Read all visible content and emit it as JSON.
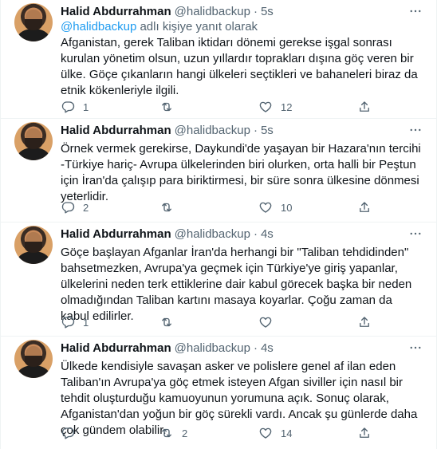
{
  "tweets": [
    {
      "name": "Halid Abdurrahman",
      "handle": "@halidbackup",
      "dot": "·",
      "time": "5s",
      "reply_mention": "@halidbackup",
      "reply_suffix": " adlı kişiye yanıt olarak",
      "text": "Afganistan, gerek Taliban iktidarı dönemi gerekse işgal sonrası kurulan yönetim olsun, uzun yıllardır toprakları dışına göç veren bir ülke. Göçe çıkanların hangi ülkeleri seçtikleri ve bahaneleri biraz da etnik kökenleriyle ilgili.",
      "replies": "1",
      "retweets": "",
      "likes": "12"
    },
    {
      "name": "Halid Abdurrahman",
      "handle": "@halidbackup",
      "dot": "·",
      "time": "5s",
      "text": "Örnek vermek gerekirse, Daykundi'de yaşayan bir Hazara'nın tercihi -Türkiye hariç- Avrupa ülkelerinden biri olurken, orta halli bir Peştun için İran'da çalışıp para biriktirmesi, bir süre sonra ülkesine dönmesi yeterlidir.",
      "replies": "2",
      "retweets": "",
      "likes": "10"
    },
    {
      "name": "Halid Abdurrahman",
      "handle": "@halidbackup",
      "dot": "·",
      "time": "4s",
      "text": "Göçe başlayan Afganlar İran'da herhangi bir \"Taliban tehdidinden\" bahsetmezken, Avrupa'ya geçmek için Türkiye'ye giriş yapanlar, ülkelerini neden terk ettiklerine dair kabul görecek başka bir neden olmadığından Taliban kartını masaya koyarlar. Çoğu zaman da kabul edilirler.",
      "replies": "1",
      "retweets": "",
      "likes": ""
    },
    {
      "name": "Halid Abdurrahman",
      "handle": "@halidbackup",
      "dot": "·",
      "time": "4s",
      "text": "Ülkede kendisiyle savaşan asker ve polislere genel af ilan eden Taliban'ın Avrupa'ya göç etmek isteyen Afgan siviller için nasıl bir tehdit oluşturduğu kamuoyunun yorumuna açık. Sonuç olarak, Afganistan'dan yoğun bir göç sürekli vardı. Ancak şu günlerde daha çok gündem olabilir.",
      "replies": "",
      "retweets": "2",
      "likes": "14"
    }
  ],
  "icons": {
    "reply": "reply-icon",
    "retweet": "retweet-icon",
    "like": "heart-icon",
    "share": "share-icon",
    "more": "more-icon"
  },
  "colors": {
    "text": "#0f1419",
    "secondary": "#536471",
    "link": "#1d9bf0",
    "border": "#eff3f4"
  }
}
